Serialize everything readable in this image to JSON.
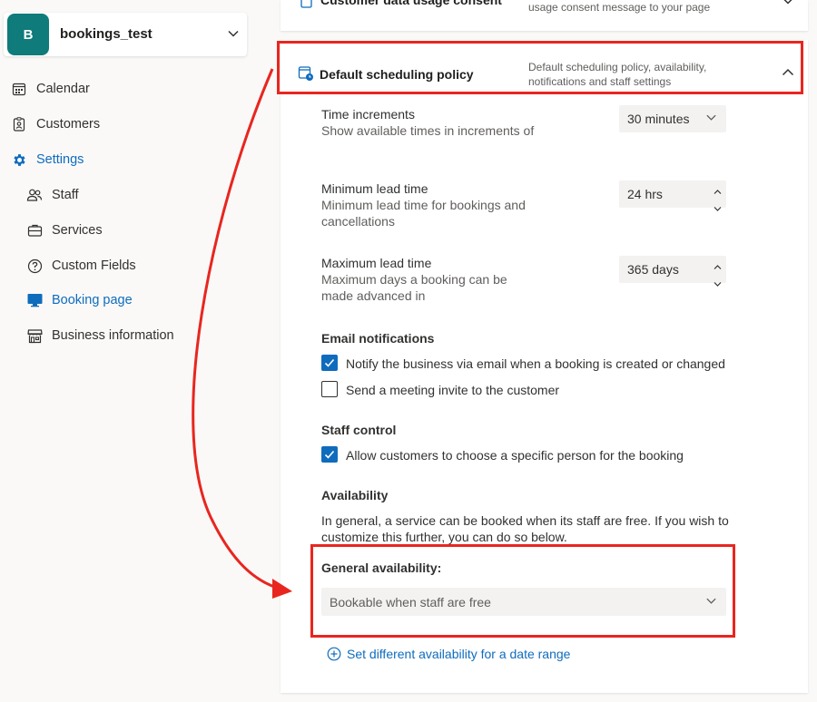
{
  "sidebar": {
    "business": {
      "initial": "B",
      "name": "bookings_test"
    },
    "nav": [
      {
        "label": "Calendar",
        "icon": "calendar-icon"
      },
      {
        "label": "Customers",
        "icon": "customers-icon"
      },
      {
        "label": "Settings",
        "icon": "gear-icon",
        "active": true
      },
      {
        "label": "Staff",
        "icon": "staff-icon"
      },
      {
        "label": "Services",
        "icon": "briefcase-icon"
      },
      {
        "label": "Custom Fields",
        "icon": "question-icon"
      },
      {
        "label": "Booking page",
        "icon": "monitor-icon",
        "active": true
      },
      {
        "label": "Business information",
        "icon": "store-icon"
      }
    ]
  },
  "collapsed_panel": {
    "title": "Customer data usage consent",
    "description": "usage consent message to your page"
  },
  "policy": {
    "title": "Default scheduling policy",
    "description": "Default scheduling policy, availability, notifications and staff settings",
    "time_increments": {
      "label": "Time increments",
      "sub": "Show available times in increments of",
      "value": "30 minutes"
    },
    "min_lead": {
      "label": "Minimum lead time",
      "sub": "Minimum lead time for bookings and cancellations",
      "value": "24 hrs"
    },
    "max_lead": {
      "label": "Maximum lead time",
      "sub": "Maximum days a booking can be made advanced in",
      "value": "365 days"
    },
    "email": {
      "heading": "Email notifications",
      "notify_business": {
        "label": "Notify the business via email when a booking is created or changed",
        "checked": true
      },
      "send_invite": {
        "label": "Send a meeting invite to the customer",
        "checked": false
      }
    },
    "staff_control": {
      "heading": "Staff control",
      "allow_choose": {
        "label": "Allow customers to choose a specific person for the booking",
        "checked": true
      }
    },
    "availability": {
      "heading": "Availability",
      "text": "In general, a service can be booked when its staff are free. If you wish to customize this further, you can do so below.",
      "general_label": "General availability:",
      "general_value": "Bookable when staff are free",
      "date_range_link": "Set different availability for a date range"
    }
  },
  "colors": {
    "accent": "#0f6cbd",
    "highlight": "#e8261f",
    "avatar": "#0f7b7b"
  }
}
